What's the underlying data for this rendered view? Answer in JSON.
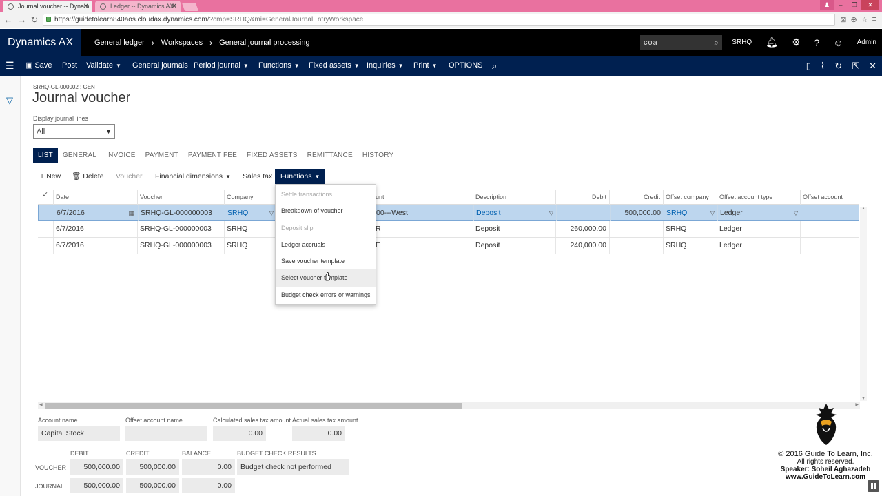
{
  "browser": {
    "tabs": [
      {
        "title": "Journal voucher -- Dynam"
      },
      {
        "title": "Ledger -- Dynamics AX"
      }
    ],
    "url_main": "https://guidetolearn840aos.cloudax.dynamics.com",
    "url_rest": "/?cmp=SRHQ&mi=GeneralJournalEntryWorkspace"
  },
  "header": {
    "brand": "Dynamics AX",
    "breadcrumbs": [
      "General ledger",
      "Workspaces",
      "General journal processing"
    ],
    "search_value": "coa",
    "company": "SRHQ",
    "user": "Admin"
  },
  "actions": {
    "save": "Save",
    "post": "Post",
    "validate": "Validate",
    "general_journals": "General journals",
    "period_journal": "Period journal",
    "functions": "Functions",
    "fixed_assets": "Fixed assets",
    "inquiries": "Inquiries",
    "print": "Print",
    "options": "OPTIONS"
  },
  "page": {
    "record_id": "SRHQ-GL-000002 : GEN",
    "title": "Journal voucher",
    "display_label": "Display journal lines",
    "display_value": "All"
  },
  "tabs": [
    "LIST",
    "GENERAL",
    "INVOICE",
    "PAYMENT",
    "PAYMENT FEE",
    "FIXED ASSETS",
    "REMITTANCE",
    "HISTORY"
  ],
  "grid_toolbar": {
    "new": "New",
    "delete": "Delete",
    "voucher": "Voucher",
    "financial_dimensions": "Financial dimensions",
    "sales_tax": "Sales tax",
    "functions": "Functions"
  },
  "grid": {
    "columns": {
      "date": "Date",
      "voucher": "Voucher",
      "company": "Company",
      "account": "unt",
      "description": "Description",
      "debit": "Debit",
      "credit": "Credit",
      "offset_company": "Offset company",
      "offset_account_type": "Offset account type",
      "offset_account": "Offset account"
    },
    "rows": [
      {
        "date": "6/7/2016",
        "voucher": "SRHQ-GL-000000003",
        "company": "SRHQ",
        "account": "00---West",
        "description": "Deposit",
        "debit": "",
        "credit": "500,000.00",
        "offset_company": "SRHQ",
        "offset_account_type": "Ledger"
      },
      {
        "date": "6/7/2016",
        "voucher": "SRHQ-GL-000000003",
        "company": "SRHQ",
        "account": "R",
        "description": "Deposit",
        "debit": "260,000.00",
        "credit": "",
        "offset_company": "SRHQ",
        "offset_account_type": "Ledger"
      },
      {
        "date": "6/7/2016",
        "voucher": "SRHQ-GL-000000003",
        "company": "SRHQ",
        "account": "E",
        "description": "Deposit",
        "debit": "240,000.00",
        "credit": "",
        "offset_company": "SRHQ",
        "offset_account_type": "Ledger"
      }
    ]
  },
  "functions_menu": [
    {
      "label": "Settle transactions",
      "disabled": true
    },
    {
      "label": "Breakdown of voucher",
      "disabled": false
    },
    {
      "label": "Deposit slip",
      "disabled": true
    },
    {
      "label": "Ledger accruals",
      "disabled": false
    },
    {
      "label": "Save voucher template",
      "disabled": false
    },
    {
      "label": "Select voucher template",
      "disabled": false
    },
    {
      "label": "Budget check errors or warnings",
      "disabled": false
    }
  ],
  "footer": {
    "account_name_label": "Account name",
    "account_name": "Capital Stock",
    "offset_account_name_label": "Offset account name",
    "offset_account_name": "",
    "calc_tax_label": "Calculated sales tax amount",
    "calc_tax": "0.00",
    "actual_tax_label": "Actual sales tax amount",
    "actual_tax": "0.00",
    "totals_headers": {
      "debit": "DEBIT",
      "credit": "CREDIT",
      "balance": "BALANCE",
      "budget": "BUDGET CHECK RESULTS"
    },
    "voucher_label": "VOUCHER",
    "voucher": {
      "debit": "500,000.00",
      "credit": "500,000.00",
      "balance": "0.00",
      "budget": "Budget check not performed"
    },
    "journal_label": "JOURNAL",
    "journal": {
      "debit": "500,000.00",
      "credit": "500,000.00",
      "balance": "0.00"
    }
  },
  "watermark": {
    "line1": "© 2016 Guide To Learn, Inc.",
    "line2": "All rights reserved.",
    "line3": "Speaker: Soheil Aghazadeh",
    "line4": "www.GuideToLearn.com"
  },
  "colors": {
    "nav_dark": "#002050",
    "top_bar": "#000000",
    "browser_chrome": "#e9719f",
    "link_blue": "#0060b0",
    "row_selected": "#bdd6ee"
  }
}
